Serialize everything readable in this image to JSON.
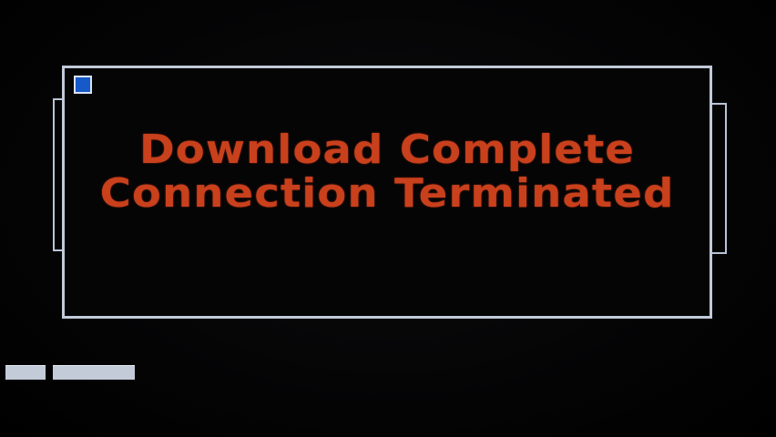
{
  "dialog": {
    "line1": "Download Complete",
    "line2": "Connection Terminated",
    "text_color": "#c9401c",
    "border_color": "#c2cad9",
    "corner_icon": "window-control-square",
    "corner_color": "#1659c9"
  },
  "taskbar": {
    "tabs": [
      "",
      ""
    ]
  }
}
